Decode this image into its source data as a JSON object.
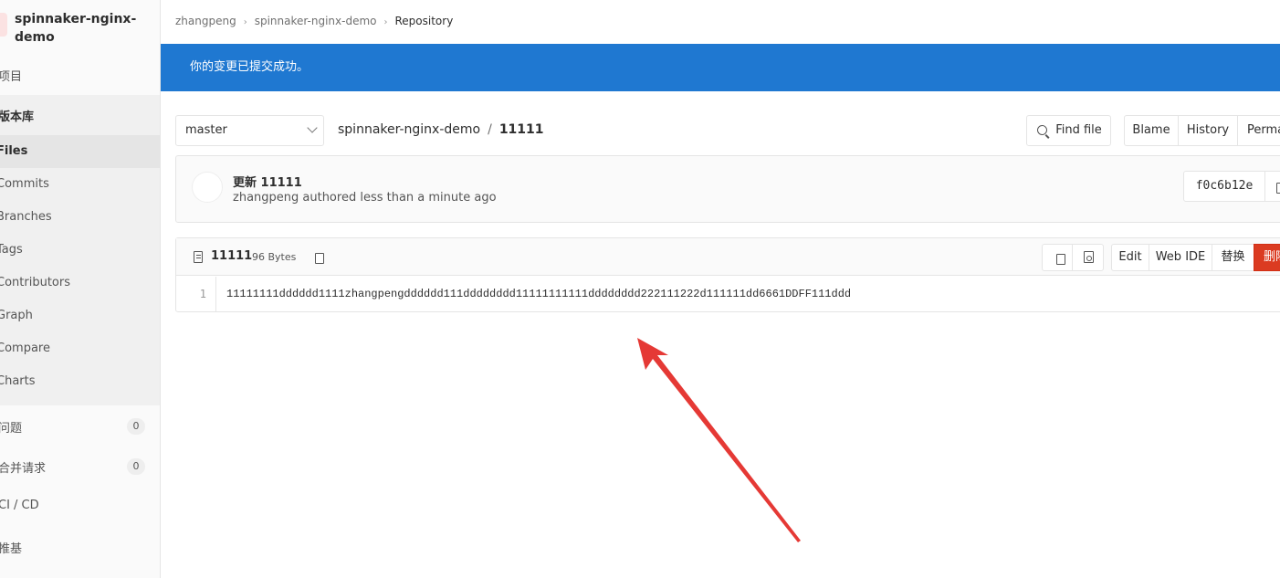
{
  "sidebar": {
    "project_name": "spinnaker-nginx-demo",
    "items": [
      {
        "label": "项目"
      },
      {
        "label": "版本库"
      },
      {
        "label": "Files"
      },
      {
        "label": "Commits"
      },
      {
        "label": "Branches"
      },
      {
        "label": "Tags"
      },
      {
        "label": "Contributors"
      },
      {
        "label": "Graph"
      },
      {
        "label": "Compare"
      },
      {
        "label": "Charts"
      },
      {
        "label": "问题",
        "count": "0"
      },
      {
        "label": "合并请求",
        "count": "0"
      },
      {
        "label": "CI / CD"
      },
      {
        "label": "推基"
      }
    ]
  },
  "breadcrumb": [
    "zhangpeng",
    "spinnaker-nginx-demo",
    "Repository"
  ],
  "flash": "你的变更已提交成功。",
  "toolbar": {
    "branch": "master",
    "path_repo": "spinnaker-nginx-demo",
    "path_sep": "/",
    "path_file": "11111",
    "find_file": "Find file",
    "blame": "Blame",
    "history": "History",
    "permalink": "Perma"
  },
  "commit": {
    "title": "更新 11111",
    "meta": "zhangpeng authored less than a minute ago",
    "sha": "f0c6b12e"
  },
  "file": {
    "name": "11111",
    "size": "96 Bytes",
    "edit": "Edit",
    "web_ide": "Web IDE",
    "replace": "替换",
    "delete": "删除",
    "line_number": "1",
    "content": "11111111dddddd1111zhangpengdddddd111dddddddd11111111111dddddddd222111222d111111dd6661DDFF111ddd"
  },
  "colors": {
    "flash_bg": "#1f78d1",
    "delete_bg": "#db3b21",
    "annotation_arrow": "#e53935"
  }
}
